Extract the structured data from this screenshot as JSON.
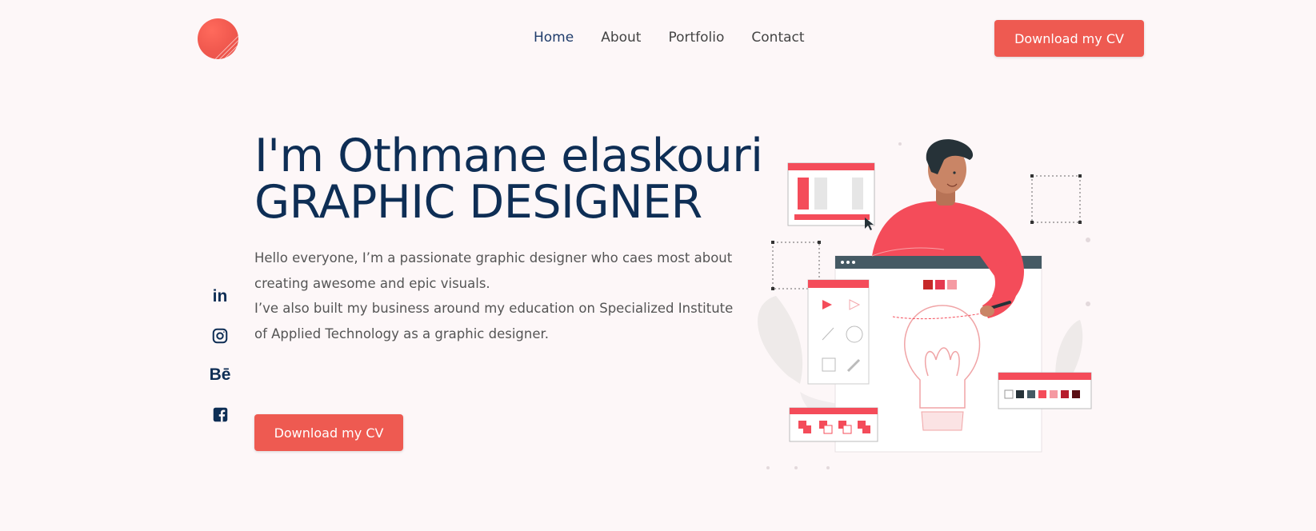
{
  "nav": {
    "items": [
      {
        "label": "Home",
        "active": true
      },
      {
        "label": "About",
        "active": false
      },
      {
        "label": "Portfolio",
        "active": false
      },
      {
        "label": "Contact",
        "active": false
      }
    ],
    "cta_label": "Download my CV"
  },
  "hero": {
    "title_line1": "I'm Othmane elaskouri",
    "title_line2": "GRAPHIC DESIGNER",
    "paragraph1": "Hello everyone, I’m a passionate graphic designer who caes most about creating awesome and epic visuals.",
    "paragraph2": "I’ve also built my business around my education on Specialized Institute of Applied Technology as a graphic designer.",
    "cta_label": "Download my CV"
  },
  "social": {
    "icons": [
      "linkedin-icon",
      "instagram-icon",
      "behance-icon",
      "facebook-icon"
    ],
    "linkedin_text": "in",
    "behance_text": "Bē"
  },
  "colors": {
    "accent": "#ee5a51",
    "heading": "#0e2e55",
    "background": "#fdf7f8",
    "body_text": "#555555"
  }
}
